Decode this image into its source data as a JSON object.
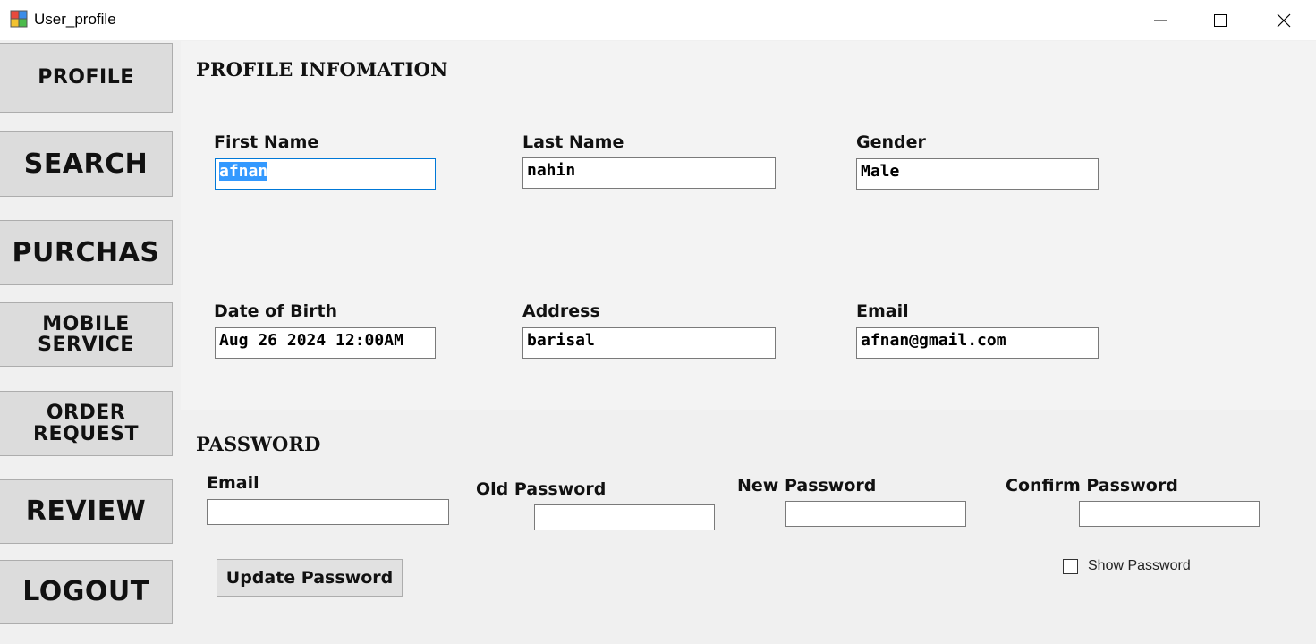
{
  "window": {
    "title": "User_profile"
  },
  "sidebar": {
    "items": [
      {
        "name": "sidebar-item-profile",
        "lines": [
          "PROFILE"
        ]
      },
      {
        "name": "sidebar-item-search",
        "lines": [
          "SEARCH"
        ]
      },
      {
        "name": "sidebar-item-purchas",
        "lines": [
          "PURCHAS"
        ]
      },
      {
        "name": "sidebar-item-mobile-service",
        "lines": [
          "MOBILE",
          "SERVICE"
        ]
      },
      {
        "name": "sidebar-item-order-request",
        "lines": [
          "ORDER",
          "REQUEST"
        ]
      },
      {
        "name": "sidebar-item-review",
        "lines": [
          "REVIEW"
        ]
      },
      {
        "name": "sidebar-item-logout",
        "lines": [
          "LOGOUT"
        ]
      }
    ]
  },
  "profile": {
    "title": "PROFILE INFOMATION",
    "first_name": {
      "label": "First Name",
      "value": "afnan"
    },
    "last_name": {
      "label": "Last Name",
      "value": "nahin"
    },
    "gender": {
      "label": "Gender",
      "value": "Male"
    },
    "dob": {
      "label": "Date of Birth",
      "value": "Aug 26 2024 12:00AM"
    },
    "address": {
      "label": "Address",
      "value": "barisal"
    },
    "email": {
      "label": "Email",
      "value": "afnan@gmail.com"
    }
  },
  "password": {
    "title": "PASSWORD",
    "email_label": "Email",
    "old_label": "Old Password",
    "new_label": "New Password",
    "confirm_label": "Confirm Password",
    "update_button": "Update Password",
    "show_password_label": "Show Password",
    "show_password_checked": false
  },
  "icons": {
    "app": "app-window-icon",
    "minimize": "minimize-icon",
    "maximize": "maximize-icon",
    "close": "close-icon"
  }
}
